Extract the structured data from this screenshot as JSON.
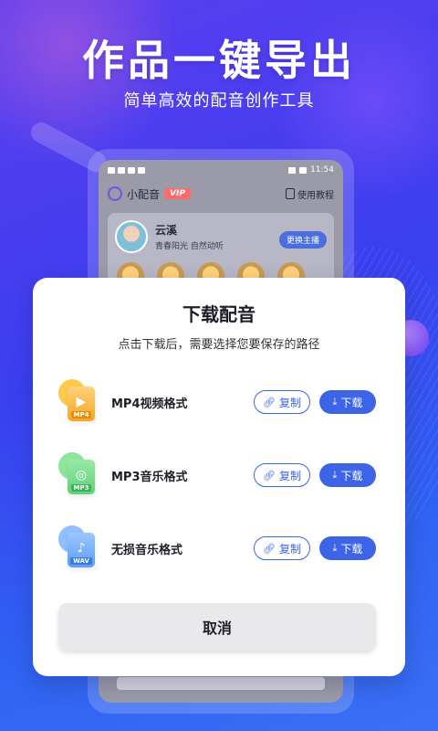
{
  "hero": {
    "title": "作品一键导出",
    "subtitle": "简单高效的配音创作工具"
  },
  "phone": {
    "status_time": "11:54",
    "app_name": "小配音",
    "vip_label": "VIP",
    "tutorial_label": "使用教程",
    "anchor": {
      "name": "云溪",
      "tags": "青春阳光 自然动听",
      "switch_label": "更换主播"
    }
  },
  "modal": {
    "title": "下载配音",
    "description": "点击下载后，需要选择您要保存的路径",
    "formats": [
      {
        "name": "MP4视频格式",
        "tag": "MP4",
        "icon": "video-icon",
        "color": "#f5a623",
        "back_color": "#ffc94d"
      },
      {
        "name": "MP3音乐格式",
        "tag": "MP3",
        "icon": "music-disc-icon",
        "color": "#5fd07a",
        "back_color": "#8de69c"
      },
      {
        "name": "无损音乐格式",
        "tag": "WAV",
        "icon": "audio-file-icon",
        "color": "#5b9cf5",
        "back_color": "#8ec0ff"
      }
    ],
    "copy_label": "复制",
    "download_label": "下载",
    "cancel_label": "取消"
  }
}
